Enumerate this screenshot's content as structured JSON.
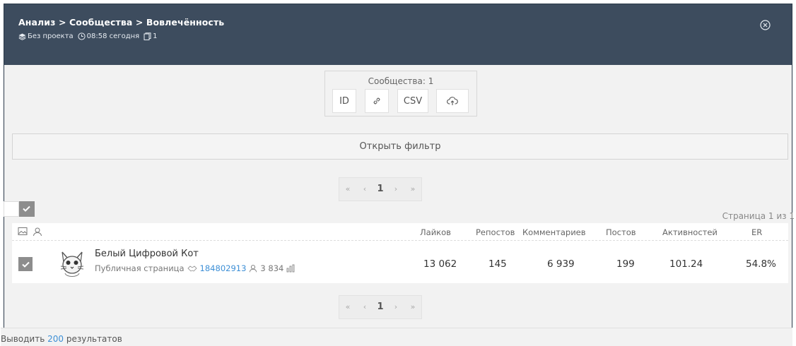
{
  "header": {
    "breadcrumb": "Анализ > Сообщества > Вовлечённость",
    "project": "Без проекта",
    "time": "08:58 сегодня",
    "doc_count": "1"
  },
  "export": {
    "caption": "Сообщества: 1",
    "id_label": "ID",
    "csv_label": "CSV"
  },
  "filter_label": "Открыть фильтр",
  "pager": {
    "first": "«",
    "prev": "‹",
    "current": "1",
    "next": "›",
    "last": "»"
  },
  "page_info": "Страница 1 из 1",
  "table": {
    "headers": [
      "Лайков",
      "Репостов",
      "Комментариев",
      "Постов",
      "Активностей",
      "ER"
    ],
    "rows": [
      {
        "name": "Белый Цифровой Кот",
        "type": "Публичная страница",
        "id": "184802913",
        "members": "3 834",
        "likes": "13 062",
        "reposts": "145",
        "comments": "6 939",
        "posts": "199",
        "activities": "101.24",
        "er": "54.8%"
      }
    ]
  },
  "footer": {
    "prefix": "Выводить",
    "count": "200",
    "suffix": "результатов"
  },
  "colors": {
    "header_bg": "#3d4c5e",
    "accent_link": "#3d8fd6",
    "check_bg": "#8d8d8d"
  },
  "icons": [
    "layers-icon",
    "clock-icon",
    "document-icon",
    "close-circle-icon",
    "link-icon",
    "cloud-upload-icon",
    "image-icon",
    "user-icon",
    "handshake-icon",
    "chart-icon",
    "check-icon"
  ]
}
